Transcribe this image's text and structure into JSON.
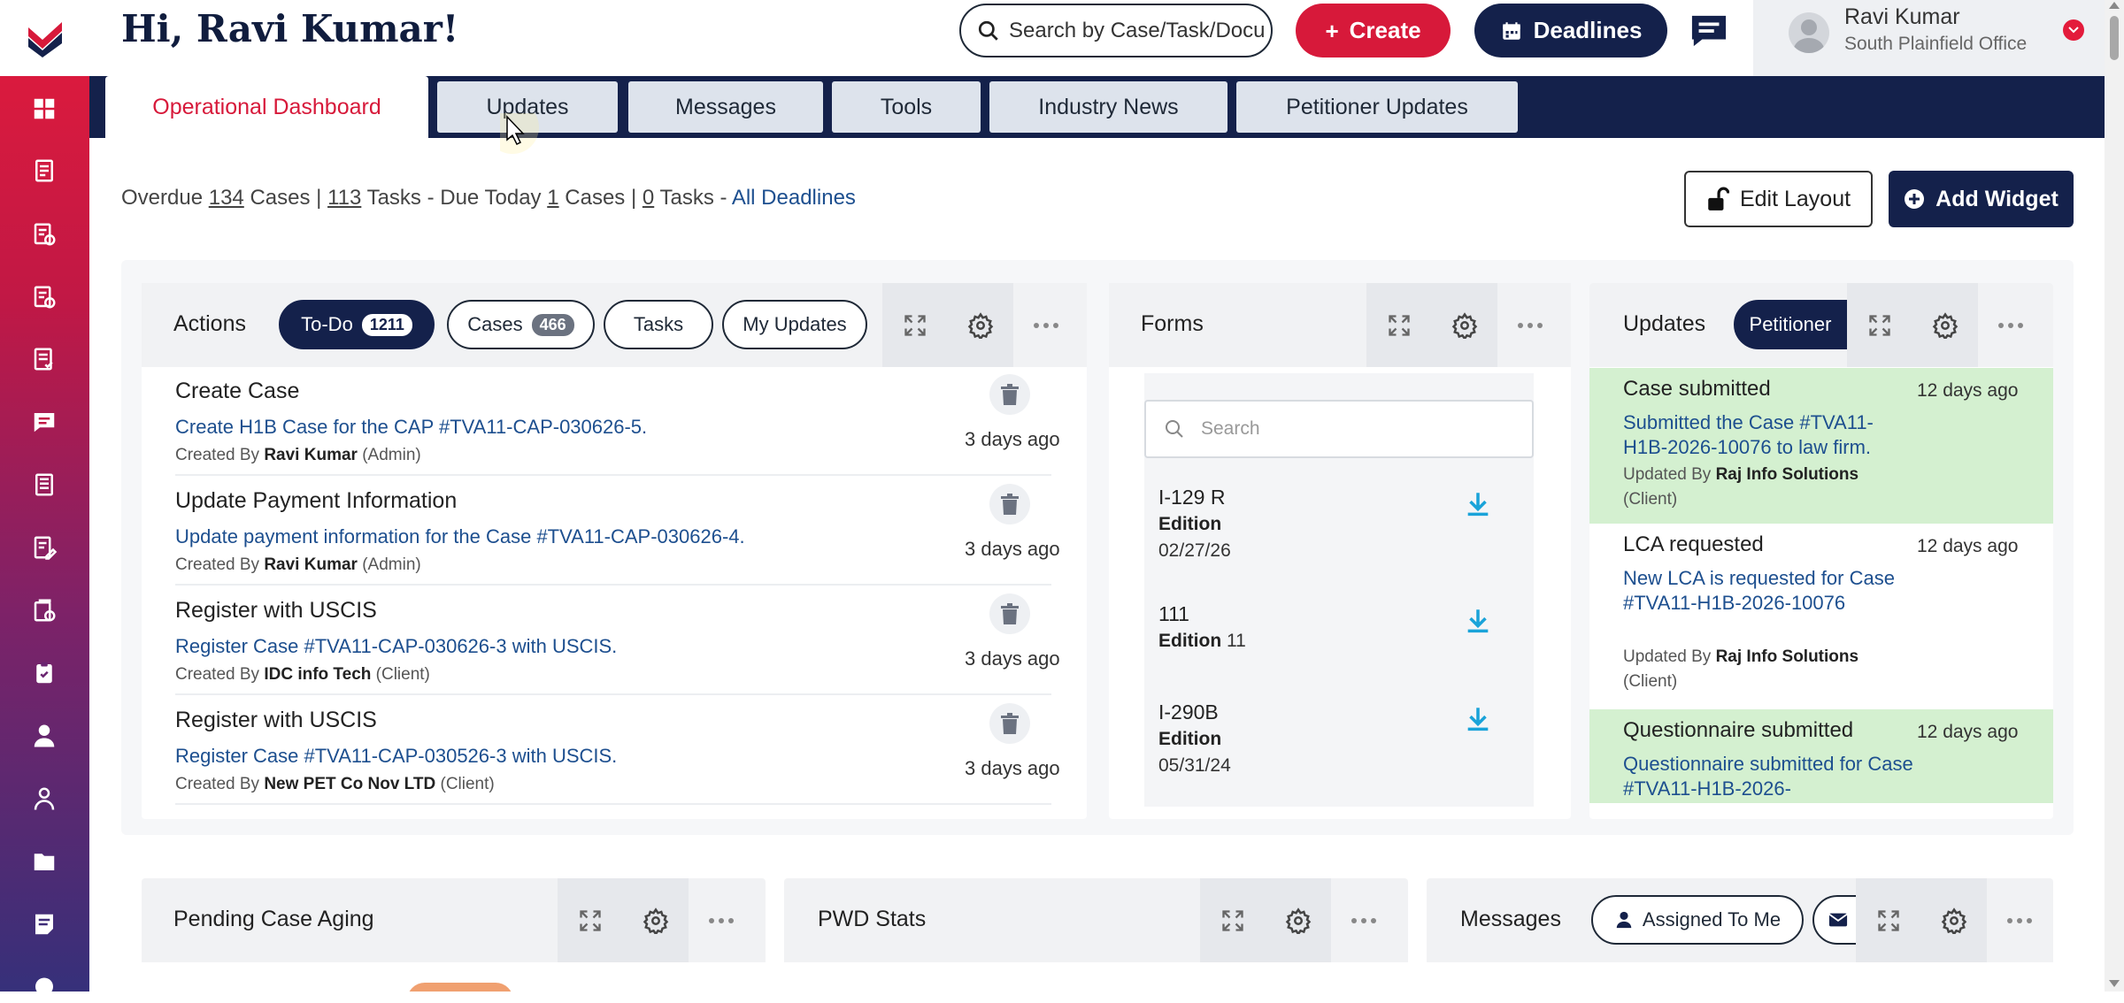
{
  "header": {
    "greeting": "Hi, Ravi Kumar!",
    "search_placeholder": "Search by Case/Task/Docu",
    "create_label": "Create",
    "deadlines_label": "Deadlines",
    "user_name": "Ravi Kumar",
    "user_office": "South Plainfield Office"
  },
  "tabs": [
    "Operational Dashboard",
    "Updates",
    "Messages",
    "Tools",
    "Industry News",
    "Petitioner Updates"
  ],
  "stats": {
    "overdue_label": "Overdue",
    "overdue_cases": "134",
    "cases_word": "Cases",
    "overdue_tasks": "113",
    "tasks_word": "Tasks",
    "due_today_label": "- Due Today",
    "due_cases": "1",
    "due_tasks": "0",
    "all_deadlines": "All Deadlines"
  },
  "buttons": {
    "edit_layout": "Edit Layout",
    "add_widget": "Add Widget"
  },
  "actions_widget": {
    "title": "Actions",
    "pills": {
      "todo": "To-Do",
      "todo_count": "1211",
      "cases": "Cases",
      "cases_count": "466",
      "tasks": "Tasks",
      "my_updates": "My Updates"
    },
    "items": [
      {
        "title": "Create Case",
        "desc": "Create H1B Case for the CAP #TVA11-CAP-030626-5.",
        "by_label": "Created By",
        "by": "Ravi Kumar",
        "role": "(Admin)",
        "time": "3 days ago"
      },
      {
        "title": "Update Payment Information",
        "desc": "Update payment information for the Case #TVA11-CAP-030626-4.",
        "by_label": "Created By",
        "by": "Ravi Kumar",
        "role": "(Admin)",
        "time": "3 days ago"
      },
      {
        "title": "Register with USCIS",
        "desc": "Register Case #TVA11-CAP-030626-3 with USCIS.",
        "by_label": "Created By",
        "by": "IDC info Tech",
        "role": "(Client)",
        "time": "3 days ago"
      },
      {
        "title": "Register with USCIS",
        "desc": "Register Case #TVA11-CAP-030526-3 with USCIS.",
        "by_label": "Created By",
        "by": "New PET Co Nov LTD",
        "role": "(Client)",
        "time": "3 days ago"
      }
    ]
  },
  "forms_widget": {
    "title": "Forms",
    "search_placeholder": "Search",
    "items": [
      {
        "name": "I-129 R",
        "edition_label": "Edition",
        "edition": "",
        "date": "02/27/26"
      },
      {
        "name": "111",
        "edition_label": "Edition",
        "edition": "11",
        "date": ""
      },
      {
        "name": "I-290B",
        "edition_label": "Edition",
        "edition": "",
        "date": "05/31/24"
      }
    ]
  },
  "updates_widget": {
    "title": "Updates",
    "pill": "Petitioner",
    "items": [
      {
        "title": "Case submitted",
        "time": "12 days ago",
        "desc": "Submitted the Case #TVA11-H1B-2026-10076 to law firm.",
        "by_label": "Updated By",
        "by": "Raj Info Solutions",
        "role": "(Client)"
      },
      {
        "title": "LCA requested",
        "time": "12 days ago",
        "desc": "New LCA is requested for Case #TVA11-H1B-2026-10076",
        "by_label": "Updated By",
        "by": "Raj Info Solutions",
        "role": "(Client)"
      },
      {
        "title": "Questionnaire submitted",
        "time": "12 days ago",
        "desc": "Questionnaire submitted for Case #TVA11-H1B-2026-"
      }
    ]
  },
  "bottom_widgets": {
    "pending": "Pending Case Aging",
    "pwd": "PWD Stats",
    "messages": "Messages",
    "assigned": "Assigned To Me"
  },
  "colors": {
    "brand_red": "#d7193a",
    "navy": "#14214b",
    "link_blue": "#1d4f8f",
    "update_green": "#d4f0d0"
  }
}
